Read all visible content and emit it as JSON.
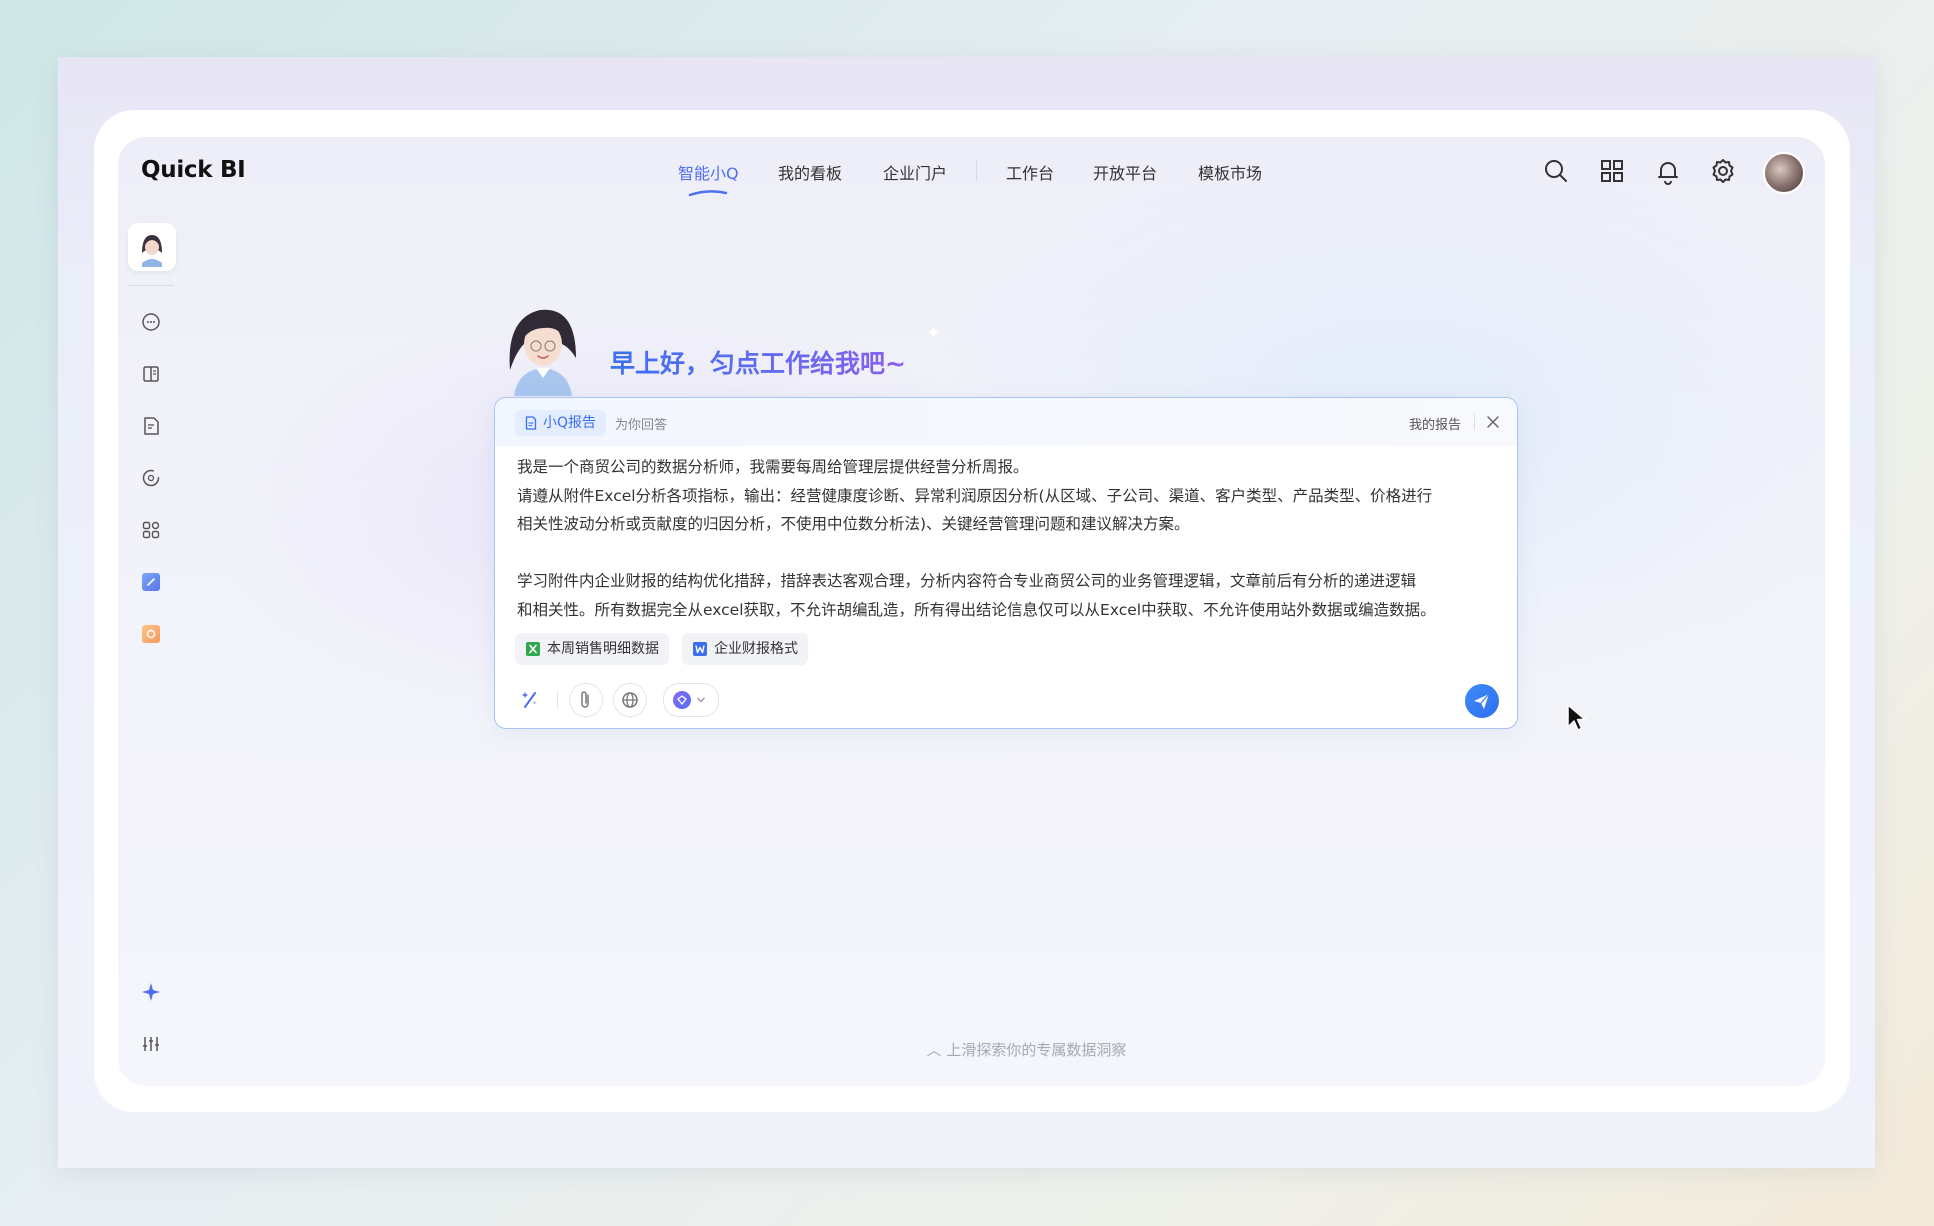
{
  "app": {
    "logo": "Quick BI"
  },
  "nav": {
    "items": [
      {
        "label": "智能小Q",
        "active": true
      },
      {
        "label": "我的看板",
        "active": false
      },
      {
        "label": "企业门户",
        "active": false
      },
      {
        "label": "工作台",
        "active": false
      },
      {
        "label": "开放平台",
        "active": false
      },
      {
        "label": "模板市场",
        "active": false
      }
    ]
  },
  "header_icons": [
    "search-icon",
    "apps-grid-icon",
    "bell-icon",
    "gear-icon",
    "user-avatar"
  ],
  "sidebar": {
    "items": [
      "assistant-avatar",
      "chat-icon",
      "book-icon",
      "report-doc-icon",
      "insight-icon",
      "apps-icon",
      "blue-app-icon",
      "orange-app-icon"
    ],
    "bottom": [
      "sparkle-icon",
      "settings-sliders-icon"
    ]
  },
  "hero": {
    "greeting": "早上好，匀点工作给我吧~"
  },
  "chat": {
    "mode_label": "小Q报告",
    "mode_sub": "为你回答",
    "my_report": "我的报告",
    "prompt_lines": [
      "我是一个商贸公司的数据分析师，我需要每周给管理层提供经营分析周报。",
      "请遵从附件Excel分析各项指标，输出：经营健康度诊断、异常利润原因分析(从区域、子公司、渠道、客户类型、产品类型、价格进行",
      "相关性波动分析或贡献度的归因分析，不使用中位数分析法)、关键经营管理问题和建议解决方案。",
      "",
      "学习附件内企业财报的结构优化措辞，措辞表达客观合理，分析内容符合专业商贸公司的业务管理逻辑，文章前后有分析的递进逻辑",
      "和相关性。所有数据完全从excel获取，不允许胡编乱造，所有得出结论信息仅可以从Excel中获取、不允许使用站外数据或编造数据。"
    ],
    "attachments": [
      {
        "name": "本周销售明细数据",
        "type": "excel",
        "color": "#2fa84f"
      },
      {
        "name": "企业财报格式",
        "type": "word",
        "color": "#3b6ef0"
      }
    ]
  },
  "footer": {
    "scroll_hint": "︿ 上滑探索你的专属数据洞察"
  },
  "colors": {
    "accent": "#4f6ef0",
    "send": "#2f6ef0"
  }
}
